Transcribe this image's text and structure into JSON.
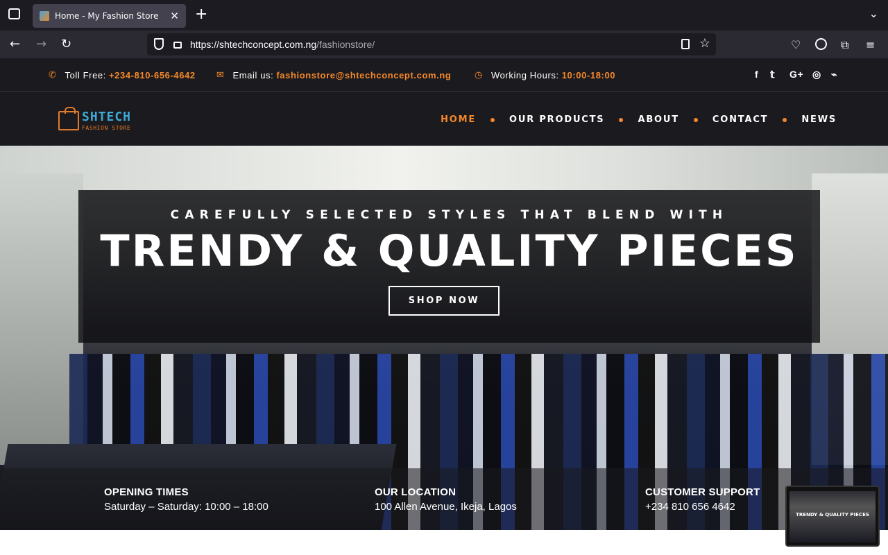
{
  "browser": {
    "tab_title": "Home - My Fashion Store",
    "url_host": "https://shtechconcept.com.ng",
    "url_path": "/fashionstore/"
  },
  "topbar": {
    "toll_label": "Toll Free:",
    "toll_value": "+234-810-656-4642",
    "email_label": "Email us:",
    "email_value": "fashionstore@shtechconcept.com.ng",
    "hours_label": "Working Hours:",
    "hours_value": "10:00-18:00",
    "social_icons": [
      "facebook-icon",
      "twitter-icon",
      "google-plus-icon",
      "dribbble-icon",
      "rss-icon"
    ]
  },
  "logo": {
    "name": "SHTECH",
    "sub": "FASHION STORE"
  },
  "menu": {
    "items": [
      "HOME",
      "OUR PRODUCTS",
      "ABOUT",
      "CONTACT",
      "NEWS"
    ],
    "active": "HOME"
  },
  "hero": {
    "kicker": "CAREFULLY SELECTED STYLES THAT BLEND WITH",
    "headline": "TRENDY & QUALITY PIECES",
    "cta": "SHOP NOW"
  },
  "info": [
    {
      "title": "OPENING TIMES",
      "value": "Saturday – Saturday: 10:00 – 18:00"
    },
    {
      "title": "OUR LOCATION",
      "value": "100 Allen Avenue, Ikeja, Lagos"
    },
    {
      "title": "CUSTOMER SUPPORT",
      "value": "+234 810 656 4642"
    }
  ],
  "pip": {
    "text": "TRENDY & QUALITY PIECES"
  },
  "colors": {
    "accent": "#f5882a",
    "dark": "#1b1b1f",
    "logo_blue": "#3fa9d6"
  }
}
